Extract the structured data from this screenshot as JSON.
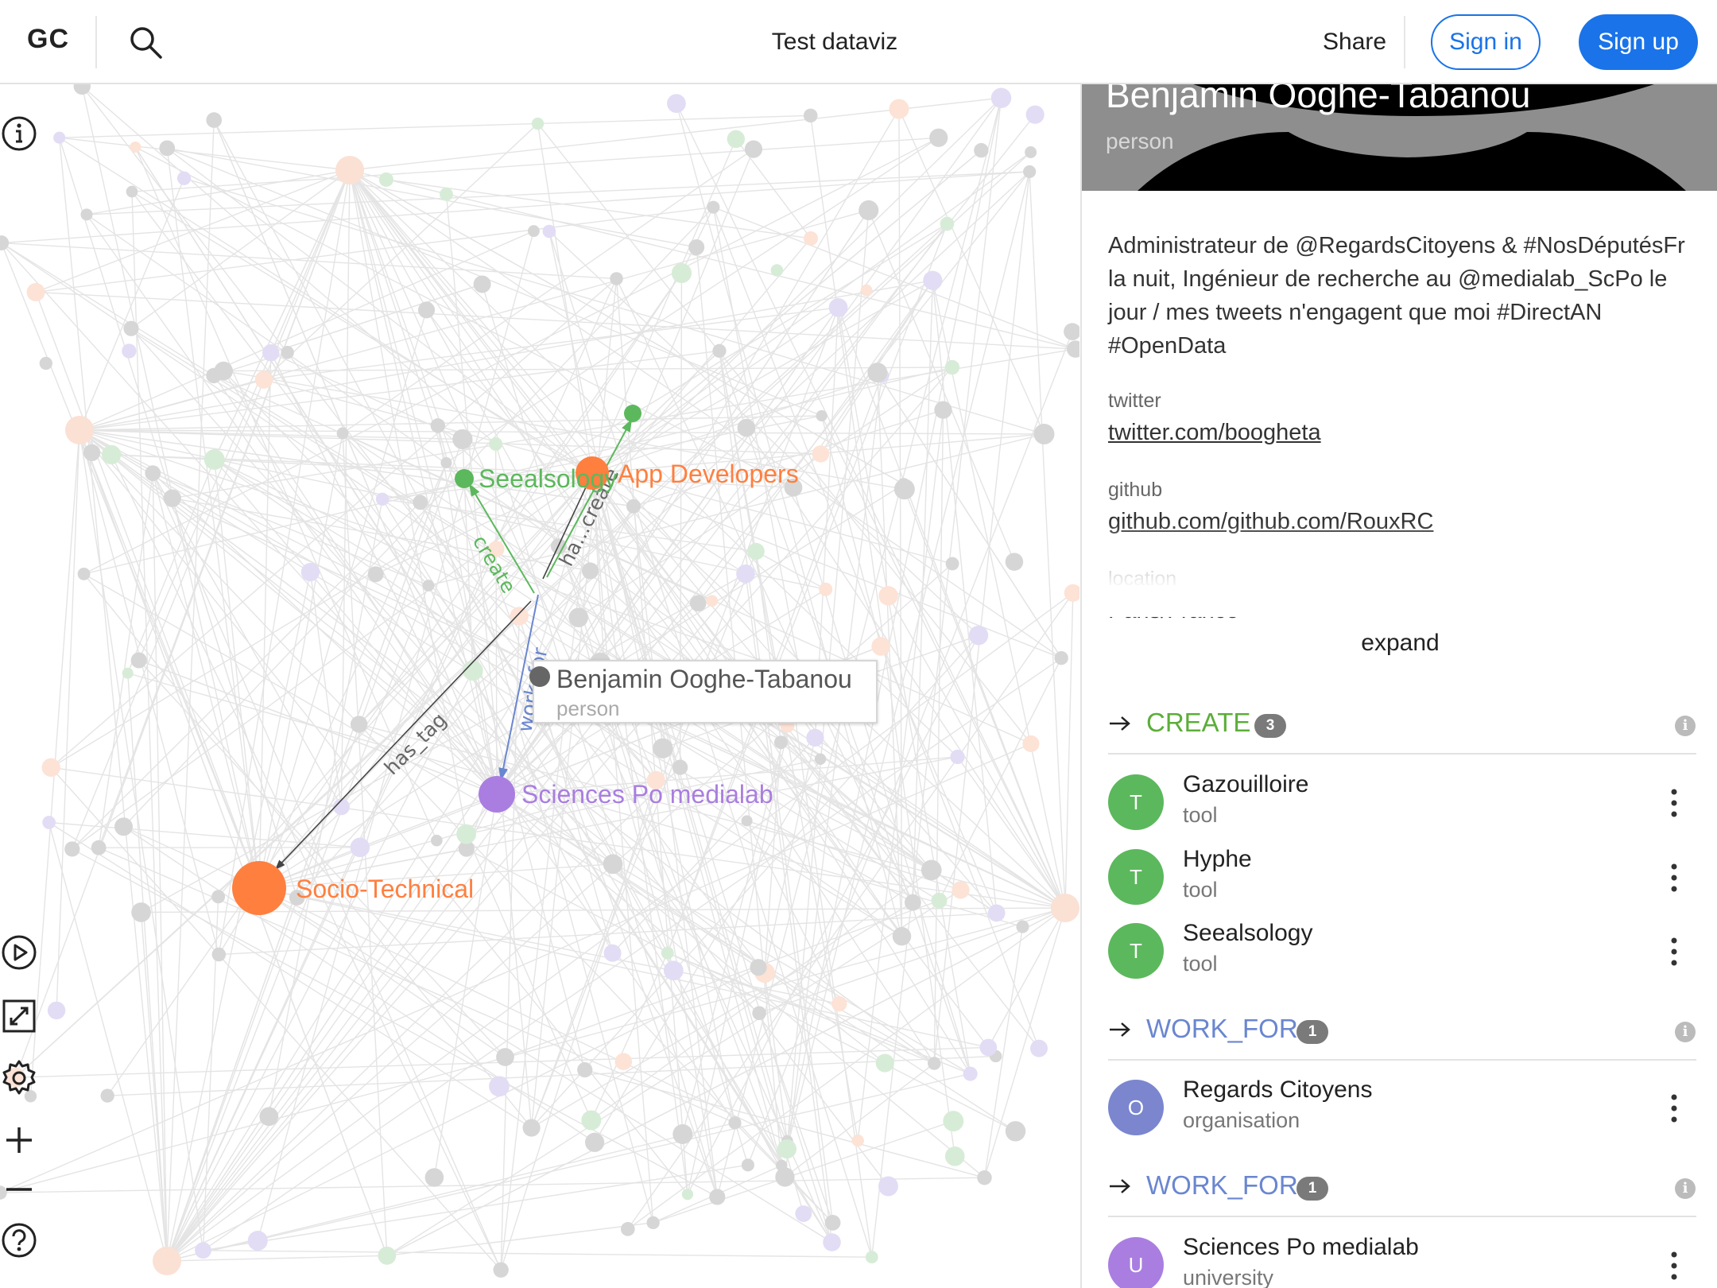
{
  "header": {
    "logo": "GC",
    "title": "Test dataviz",
    "share_label": "Share",
    "signin_label": "Sign in",
    "signup_label": "Sign up"
  },
  "graph": {
    "nodes": [
      {
        "label": "Seealsology",
        "color": "#5cb85c"
      },
      {
        "label": "App Developers",
        "color": "#ff7f3f"
      },
      {
        "label": "Sciences Po medialab",
        "color": "#a97ee0"
      },
      {
        "label": "Socio-Technical",
        "color": "#ff7f3f"
      }
    ],
    "edges": [
      {
        "label": "create"
      },
      {
        "label": "ha...create"
      },
      {
        "label": "work_for"
      },
      {
        "label": "has_tag"
      }
    ],
    "selected": {
      "label": "Benjamin Ooghe-Tabanou",
      "type": "person"
    },
    "controls": [
      "info-icon",
      "play-icon",
      "fullscreen-icon",
      "settings-icon",
      "zoom-in-icon",
      "zoom-out-icon",
      "help-icon"
    ]
  },
  "panel": {
    "name": "Benjamin Ooghe-Tabanou",
    "type": "person",
    "description": "Administrateur de @RegardsCitoyens & #NosDéputésFr la nuit, Ingénieur de recherche au @medialab_ScPo le jour / mes tweets n'engagent que moi #DirectAN #OpenData",
    "fields": [
      {
        "label": "twitter",
        "value": "twitter.com/boogheta"
      },
      {
        "label": "github",
        "value": "github.com/github.com/RouxRC"
      },
      {
        "label": "location",
        "value": "Paris/France"
      }
    ],
    "expand_label": "expand",
    "sections": [
      {
        "label": "CREATE",
        "count": "3",
        "color": "#5cae3a",
        "items": [
          {
            "initial": "T",
            "name": "Gazouilloire",
            "type": "tool",
            "color": "#5cb85c"
          },
          {
            "initial": "T",
            "name": "Hyphe",
            "type": "tool",
            "color": "#5cb85c"
          },
          {
            "initial": "T",
            "name": "Seealsology",
            "type": "tool",
            "color": "#5cb85c"
          }
        ]
      },
      {
        "label": "WORK_FOR",
        "count": "1",
        "color": "#6a86d0",
        "items": [
          {
            "initial": "O",
            "name": "Regards Citoyens",
            "type": "organisation",
            "color": "#7b86cf"
          }
        ]
      },
      {
        "label": "WORK_FOR",
        "count": "1",
        "color": "#6a86d0",
        "items": [
          {
            "initial": "U",
            "name": "Sciences Po medialab",
            "type": "university",
            "color": "#a97ee0"
          }
        ]
      }
    ]
  }
}
